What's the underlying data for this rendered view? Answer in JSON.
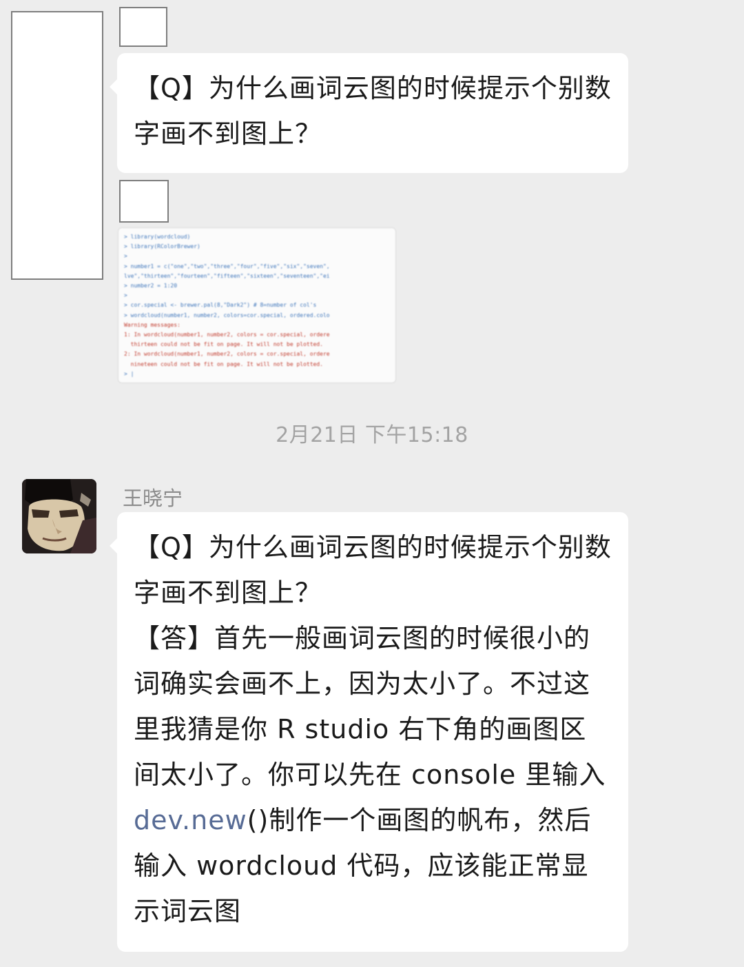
{
  "messages": [
    {
      "id": "m1",
      "sender": "",
      "text": "【Q】为什么画词云图的时候提示个别数字画不到图上？"
    },
    {
      "id": "m2",
      "sender": "",
      "type": "image",
      "code_lines": [
        "> library(wordcloud)",
        "> library(RColorBrewer)",
        ">",
        "> number1 = c(\"one\",\"two\",\"three\",\"four\",\"five\",\"six\",\"seven\",",
        "lve\",\"thirteen\",\"fourteen\",\"fifteen\",\"sixteen\",\"seventeen\",\"ei",
        "> number2 = 1:20",
        ">",
        "> cor.special <- brewer.pal(8,\"Dark2\") # 8=number of col's",
        "> wordcloud(number1, number2, colors=cor.special, ordered.colo",
        "Warning messages:",
        "1: In wordcloud(number1, number2, colors = cor.special, ordere",
        "  thirteen could not be fit on page. It will not be plotted.",
        "2: In wordcloud(number1, number2, colors = cor.special, ordere",
        "  nineteen could not be fit on page. It will not be plotted.",
        "> |"
      ]
    },
    {
      "id": "ts",
      "timestamp": "2月21日 下午15:18"
    },
    {
      "id": "m3",
      "sender": "王晓宁",
      "text_before_link": "【Q】为什么画词云图的时候提示个别数字画不到图上？\n【答】首先一般画词云图的时候很小的词确实会画不上，因为太小了。不过这里我猜是你 R studio 右下角的画图区间太小了。你可以先在 console 里输入 ",
      "link": "dev.new",
      "text_after_link": "()制作一个画图的帆布，然后输入 wordcloud 代码，应该能正常显示词云图"
    }
  ],
  "colors": {
    "background": "#ededed",
    "bubble": "#ffffff",
    "link": "#576b95",
    "timestamp": "#a3a3a3",
    "warning": "#c0392b",
    "prompt": "#3b73b9"
  },
  "icons": {
    "avatar_photo": "avatar-photo-icon"
  }
}
